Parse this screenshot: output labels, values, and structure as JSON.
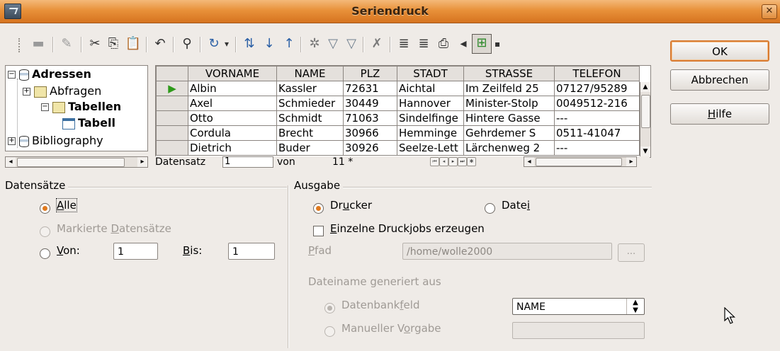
{
  "window": {
    "title": "Seriendruck"
  },
  "buttons": {
    "ok": "OK",
    "cancel": "Abbrechen",
    "help": "Hilfe"
  },
  "tree": {
    "items": [
      {
        "label": "Adressen",
        "bold": true
      },
      {
        "label": "Abfragen",
        "bold": false
      },
      {
        "label": "Tabellen",
        "bold": true
      },
      {
        "label": "Tabell",
        "bold": true
      },
      {
        "label": "Bibliography",
        "bold": false
      }
    ]
  },
  "grid": {
    "columns": [
      "VORNAME",
      "NAME",
      "PLZ",
      "STADT",
      "STRASSE",
      "TELEFON"
    ],
    "rows": [
      [
        "Albin",
        "Kassler",
        "72631",
        "Aichtal",
        "Im Zeilfeld 25",
        "07127/95289"
      ],
      [
        "Axel",
        "Schmieder",
        "30449",
        "Hannover",
        "Minister-Stolp",
        "0049512-216"
      ],
      [
        "Otto",
        "Schmidt",
        "71063",
        "Sindelfinge",
        "Hintere Gasse",
        "---"
      ],
      [
        "Cordula",
        "Brecht",
        "30966",
        "Hemminge",
        "Gehrdemer S",
        "0511-41047"
      ],
      [
        "Dietrich",
        "Buder",
        "30926",
        "Seelze-Lett",
        "Lärchenweg 2",
        "---"
      ]
    ],
    "nav": {
      "label": "Datensatz",
      "current": "1",
      "of": "von",
      "total": "11 *"
    }
  },
  "datensaetze": {
    "title": "Datensätze",
    "all": "Alle",
    "marked": "Markierte Datensätze",
    "from": "Von:",
    "from_value": "1",
    "to": "Bis:",
    "to_value": "1"
  },
  "ausgabe": {
    "title": "Ausgabe",
    "printer": "Drucker",
    "file": "Datei",
    "single_jobs": "Einzelne Druckjobs erzeugen",
    "path_label": "Pfad",
    "path_value": "/home/wolle2000",
    "browse": "...",
    "filename_from": "Dateiname generiert aus",
    "db_field": "Datenbankfeld",
    "db_field_value": "NAME",
    "manual": "Manueller Vorgabe",
    "manual_value": ""
  },
  "colors": {
    "title_bar": "#e8913a",
    "selected_radio": "#e07a1f",
    "default_button_border": "#d87b32",
    "record_marker": "#2e9a1a"
  }
}
